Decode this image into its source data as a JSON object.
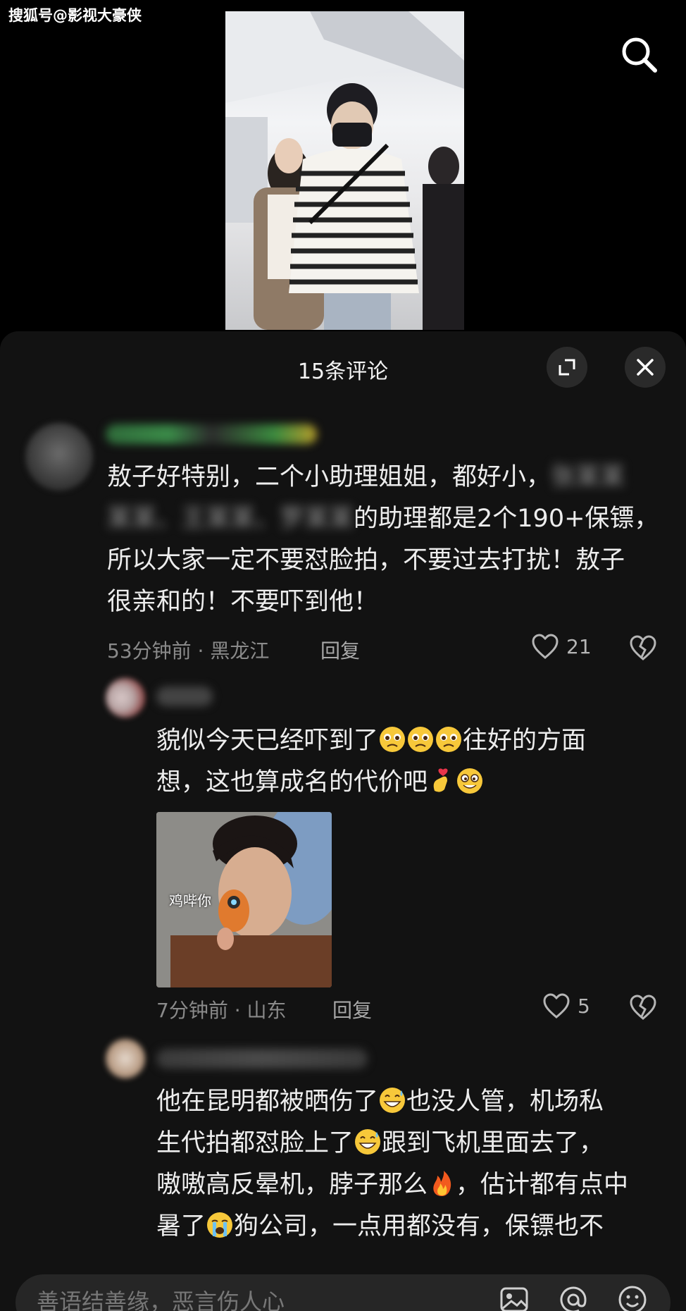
{
  "watermark": "搜狐号@影视大豪侠",
  "panel": {
    "title": "15条评论"
  },
  "comments": [
    {
      "text_lines": [
        "敖子好特别，二个小助理姐姐，都好小，",
        "的助理都是2个190+保镖，",
        "所以大家一定不要怼脸拍，不要过去打扰！敖子",
        "很亲和的！不要吓到他！"
      ],
      "meta": "53分钟前 · 黑龙江",
      "reply_label": "回复",
      "likes": "21"
    },
    {
      "text_lines": [
        "貌似今天已经吓到了",
        "往好的方面",
        "想，这也算成名的代价吧"
      ],
      "sticker_caption": "鸡哔你",
      "meta": "7分钟前 · 山东",
      "reply_label": "回复",
      "likes": "5"
    },
    {
      "text_lines": [
        "他在昆明都被晒伤了",
        "也没人管，机场私",
        "生代拍都怼脸上了",
        "跟到飞机里面去了，",
        "嗷嗷高反晕机，脖子那么",
        "，估计都有点中",
        "暑了",
        "狗公司，一点用都没有，保镖也不"
      ]
    }
  ],
  "input": {
    "placeholder": "善语结善缘，恶言伤人心"
  },
  "icons": [
    "search-icon",
    "expand-icon",
    "close-icon",
    "heart-icon",
    "dislike-icon",
    "image-icon",
    "mention-icon",
    "emoji-icon"
  ],
  "colors": {
    "background": "#000000",
    "sheet": "#121212",
    "text": "#ededed",
    "meta": "#8a8a8a"
  }
}
